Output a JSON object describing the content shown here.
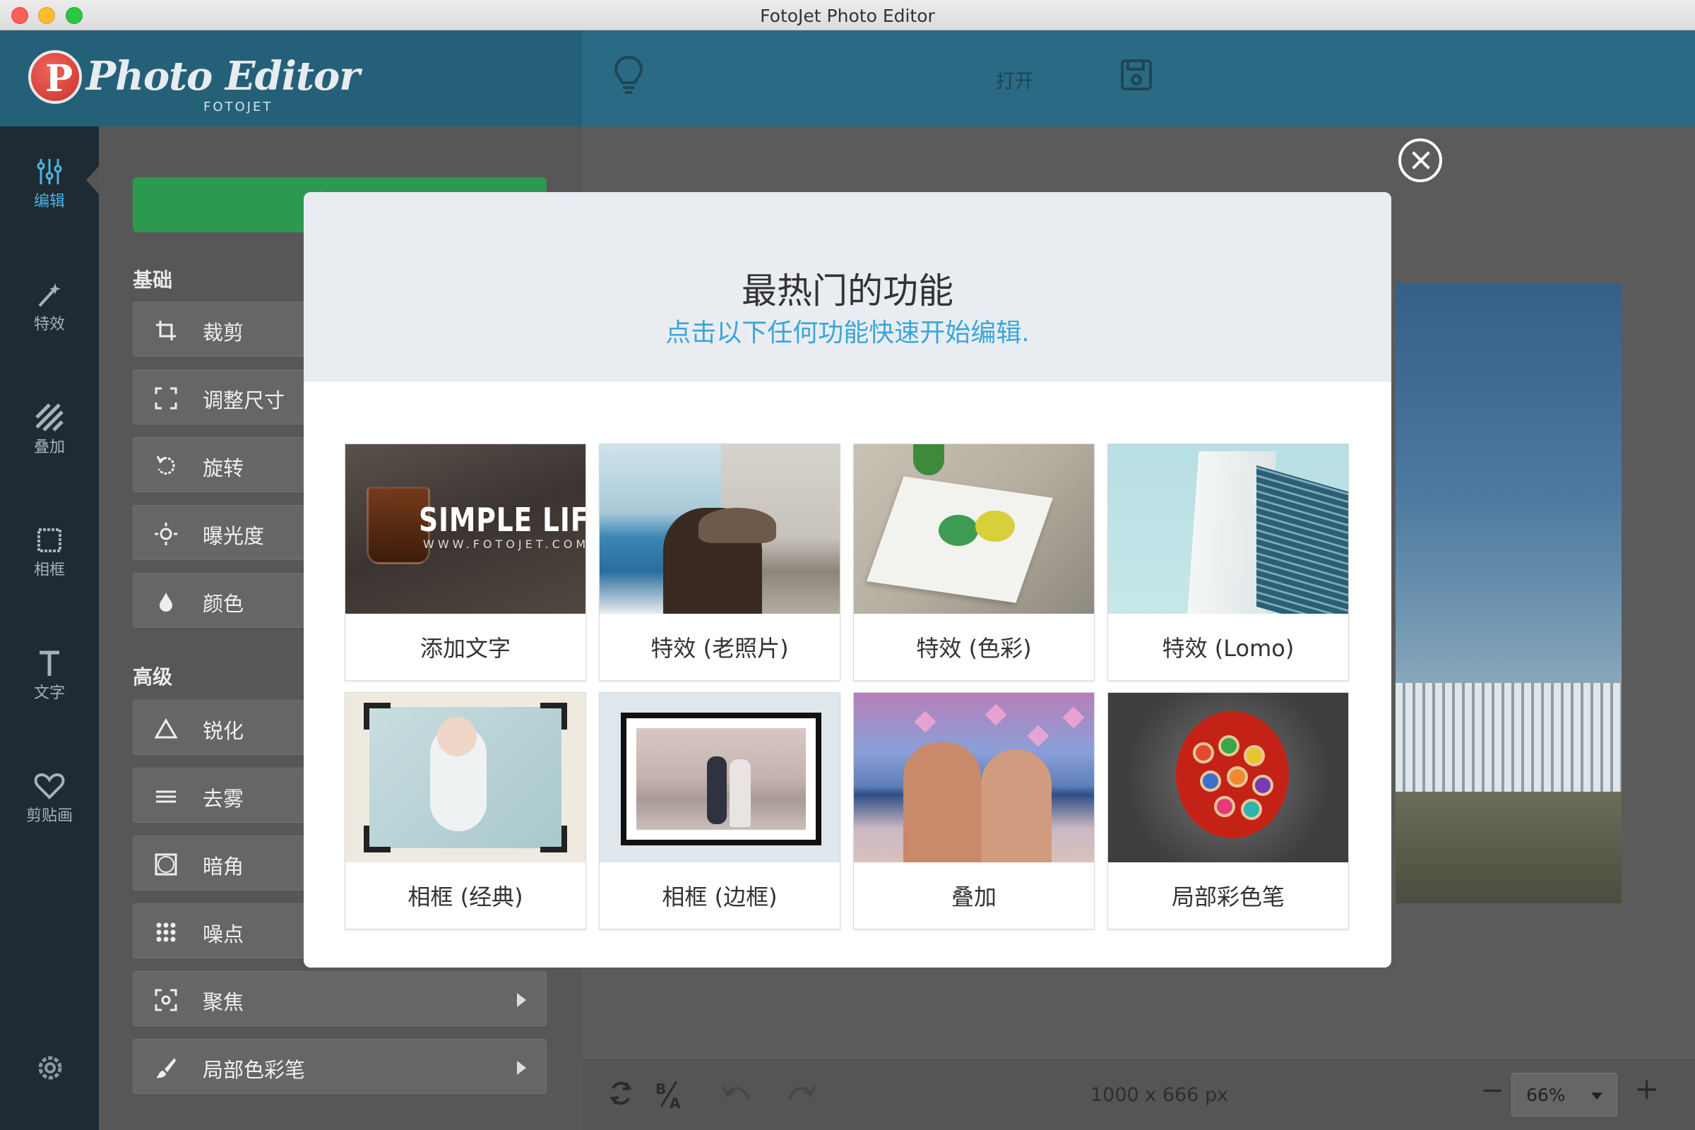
{
  "window": {
    "title": "FotoJet Photo Editor"
  },
  "header": {
    "logo_text": "Photo Editor",
    "logo_sub": "FOTOJET",
    "logo_badge": "P",
    "open_label": "打开"
  },
  "nav": {
    "items": [
      {
        "label": "编辑",
        "icon": "sliders-icon",
        "active": true
      },
      {
        "label": "特效",
        "icon": "magic-wand-icon"
      },
      {
        "label": "叠加",
        "icon": "stripes-icon"
      },
      {
        "label": "相框",
        "icon": "frame-icon"
      },
      {
        "label": "文字",
        "icon": "text-icon"
      },
      {
        "label": "剪贴画",
        "icon": "heart-icon"
      }
    ]
  },
  "panel": {
    "basic_label": "基础",
    "basic_tools": [
      {
        "label": "裁剪",
        "icon": "crop-icon"
      },
      {
        "label": "调整尺寸",
        "icon": "resize-icon"
      },
      {
        "label": "旋转",
        "icon": "rotate-icon"
      },
      {
        "label": "曝光度",
        "icon": "sun-icon"
      },
      {
        "label": "颜色",
        "icon": "drop-icon"
      }
    ],
    "advanced_label": "高级",
    "advanced_tools": [
      {
        "label": "锐化",
        "icon": "triangle-icon"
      },
      {
        "label": "去雾",
        "icon": "lines-icon"
      },
      {
        "label": "暗角",
        "icon": "vignette-icon"
      },
      {
        "label": "噪点",
        "icon": "dots-icon"
      },
      {
        "label": "聚焦",
        "icon": "focus-icon",
        "has_arrow": true
      },
      {
        "label": "局部色彩笔",
        "icon": "brush-icon",
        "has_arrow": true
      }
    ]
  },
  "bottombar": {
    "image_size": "1000 x 666 px",
    "zoom_value": "66%",
    "zoom_minus": "−",
    "zoom_plus": "+"
  },
  "modal": {
    "title": "最热门的功能",
    "subtitle": "点击以下任何功能快速开始编辑.",
    "cards": [
      {
        "label": "添加文字",
        "thumb_text": "SIMPLE LIFE",
        "thumb_sub": "WWW.FOTOJET.COM"
      },
      {
        "label": "特效 (老照片)"
      },
      {
        "label": "特效 (色彩)"
      },
      {
        "label": "特效 (Lomo)"
      },
      {
        "label": "相框 (经典)"
      },
      {
        "label": "相框 (边框)"
      },
      {
        "label": "叠加"
      },
      {
        "label": "局部彩色笔"
      }
    ]
  },
  "colors": {
    "header": "#256079",
    "nav_bg": "#1f2a33",
    "accent_blue": "#3ba6d8",
    "green": "#2b9a4e"
  }
}
